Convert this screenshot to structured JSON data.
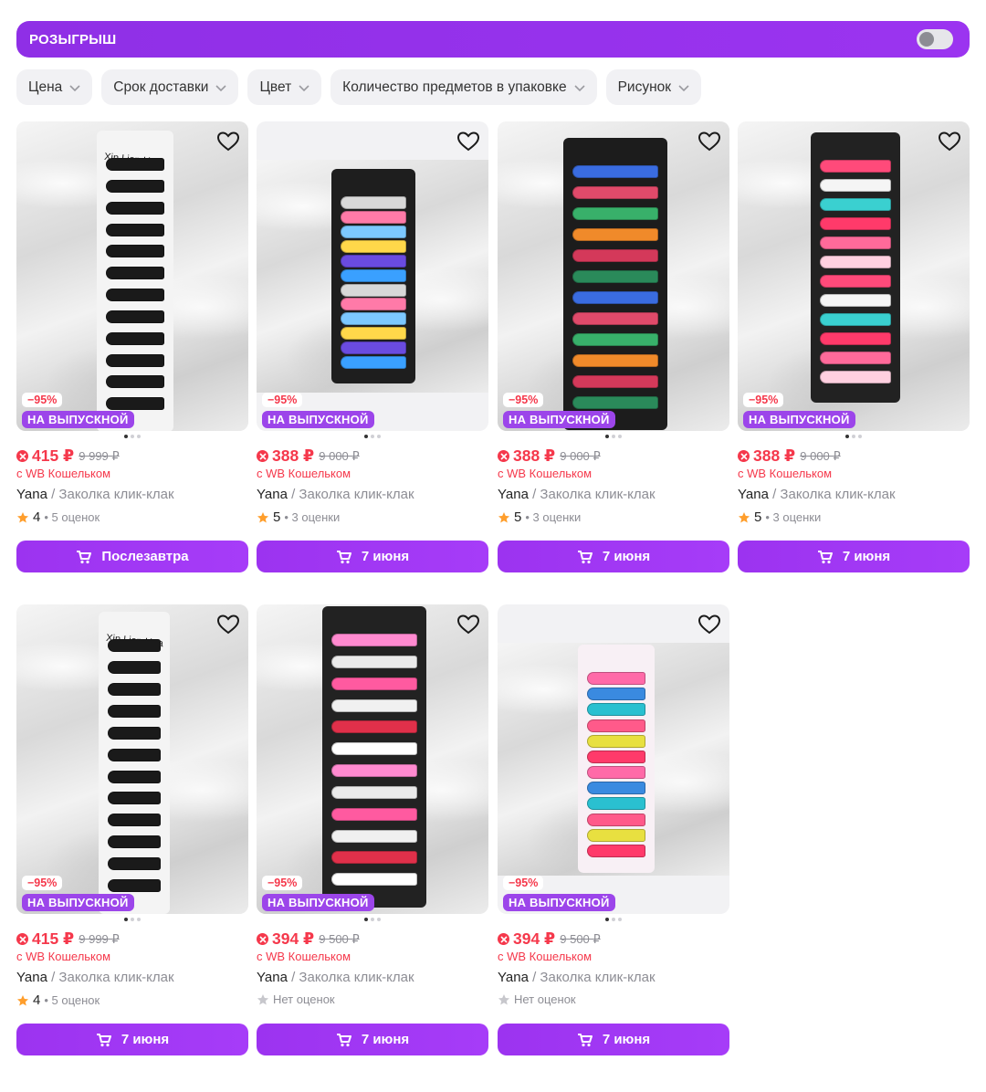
{
  "promo": {
    "label": "РОЗЫГРЫШ",
    "toggle_on": false
  },
  "filters": [
    "Цена",
    "Срок доставки",
    "Цвет",
    "Количество предметов в упаковке",
    "Рисунок"
  ],
  "products": [
    {
      "discount": "−95%",
      "event": "НА ВЫПУСКНОЙ",
      "price": "415 ₽",
      "old_price": "9 999 ₽",
      "wallet": "с WB Кошельком",
      "brand": "Yana",
      "name": " / Заколка клик-клак",
      "rating": "4",
      "reviews": "• 5 оценок",
      "delivery": "Послезавтра"
    },
    {
      "discount": "−95%",
      "event": "НА ВЫПУСКНОЙ",
      "price": "388 ₽",
      "old_price": "9 000 ₽",
      "wallet": "с WB Кошельком",
      "brand": "Yana",
      "name": " / Заколка клик-клак",
      "rating": "5",
      "reviews": "• 3 оценки",
      "delivery": "7 июня"
    },
    {
      "discount": "−95%",
      "event": "НА ВЫПУСКНОЙ",
      "price": "388 ₽",
      "old_price": "9 000 ₽",
      "wallet": "с WB Кошельком",
      "brand": "Yana",
      "name": " / Заколка клик-клак",
      "rating": "5",
      "reviews": "• 3 оценки",
      "delivery": "7 июня"
    },
    {
      "discount": "−95%",
      "event": "НА ВЫПУСКНОЙ",
      "price": "388 ₽",
      "old_price": "9 000 ₽",
      "wallet": "с WB Кошельком",
      "brand": "Yana",
      "name": " / Заколка клик-клак",
      "rating": "5",
      "reviews": "• 3 оценки",
      "delivery": "7 июня"
    },
    {
      "discount": "−95%",
      "event": "НА ВЫПУСКНОЙ",
      "price": "415 ₽",
      "old_price": "9 999 ₽",
      "wallet": "с WB Кошельком",
      "brand": "Yana",
      "name": " / Заколка клик-клак",
      "rating": "4",
      "reviews": "• 5 оценок",
      "delivery": "7 июня"
    },
    {
      "discount": "−95%",
      "event": "НА ВЫПУСКНОЙ",
      "price": "394 ₽",
      "old_price": "9 500 ₽",
      "wallet": "с WB Кошельком",
      "brand": "Yana",
      "name": " / Заколка клик-клак",
      "rating": "",
      "reviews": "Нет оценок",
      "delivery": "7 июня"
    },
    {
      "discount": "−95%",
      "event": "НА ВЫПУСКНОЙ",
      "price": "394 ₽",
      "old_price": "9 500 ₽",
      "wallet": "с WB Кошельком",
      "brand": "Yana",
      "name": " / Заколка клик-клак",
      "rating": "",
      "reviews": "Нет оценок",
      "delivery": "7 июня"
    }
  ],
  "photo_labels": {
    "xin_lian_hua": "Xin Lian Hua"
  },
  "colors": {
    "accent": "#a73afd",
    "price": "#f5384b",
    "event_badge": "#9c45ea",
    "star": "#ff9e2c"
  }
}
